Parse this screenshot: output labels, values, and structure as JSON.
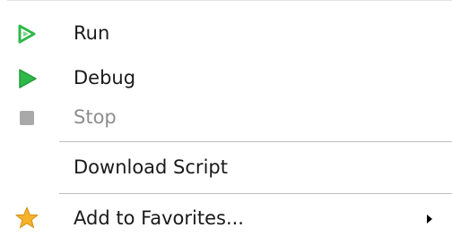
{
  "menu": {
    "items": [
      {
        "label": "Run",
        "icon": "run-outline-play-icon",
        "enabled": true
      },
      {
        "label": "Debug",
        "icon": "debug-play-icon",
        "enabled": true
      },
      {
        "label": "Stop",
        "icon": "stop-square-icon",
        "enabled": false
      },
      {
        "label": "Download Script",
        "icon": "",
        "enabled": true
      },
      {
        "label": "Add to Favorites...",
        "icon": "star-icon",
        "enabled": true,
        "has_submenu": true
      }
    ]
  },
  "colors": {
    "play_green": "#2fb84a",
    "star_gold": "#f4b32a",
    "disabled_gray": "#8e8e8e",
    "stop_gray": "#a9a9a9"
  }
}
